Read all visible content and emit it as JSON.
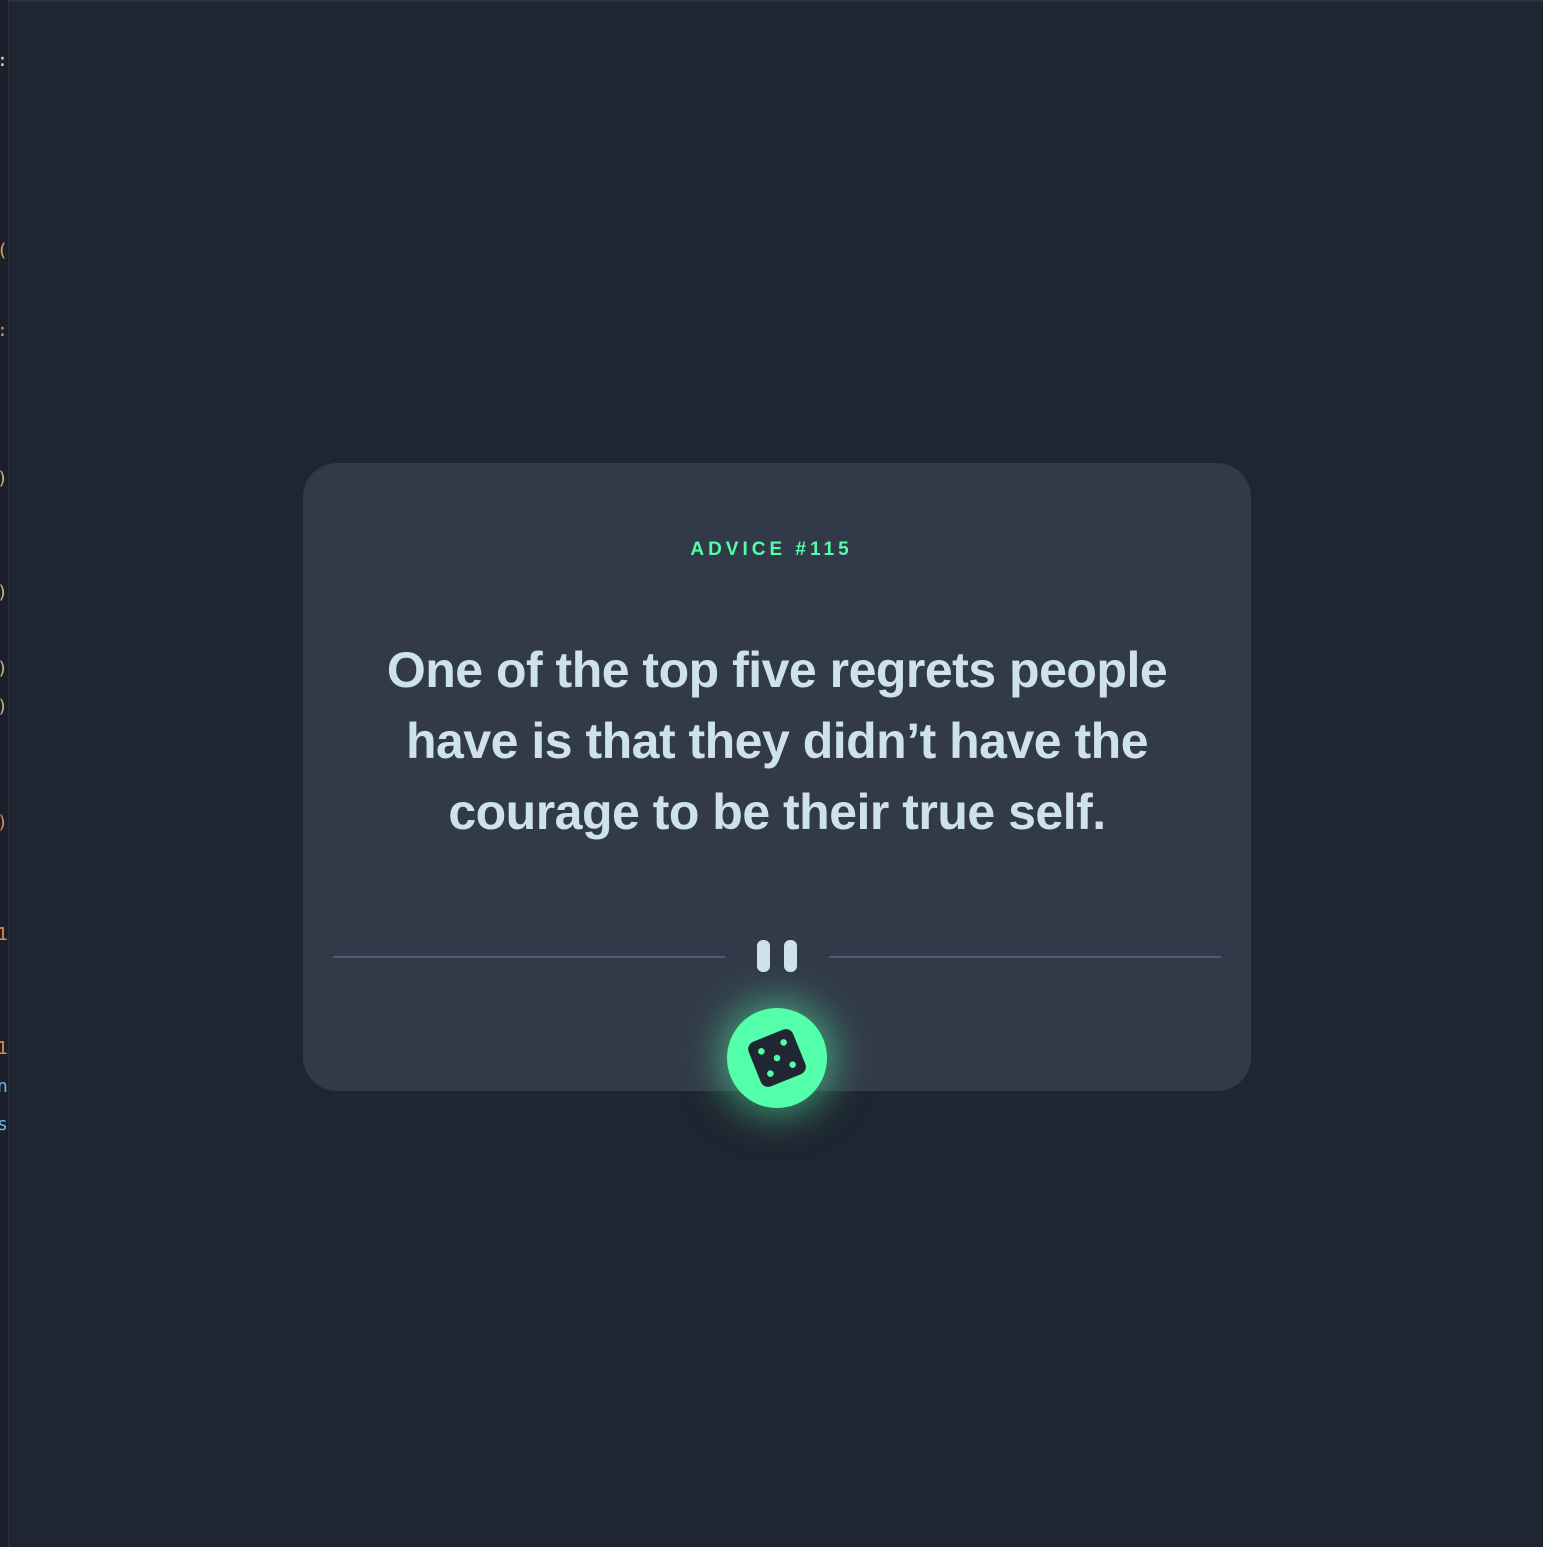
{
  "colors": {
    "page_background": "#202632",
    "card_background": "#323a49",
    "accent_green": "#52ffa8",
    "text_light": "#cee3e9",
    "divider": "#4f5d74",
    "dice_dark": "#202632"
  },
  "advice": {
    "id_label": "ADVICE #115",
    "quote": "One of the top five regrets people have is that they didn’t have the courage to be their true self."
  },
  "icons": {
    "divider_icon": "pause-icon",
    "button_icon": "dice-icon"
  }
}
